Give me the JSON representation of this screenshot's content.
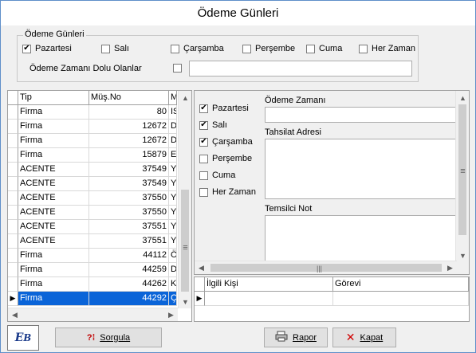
{
  "window": {
    "title": "Ödeme Günleri"
  },
  "filter": {
    "group_label": "Ödeme Günleri",
    "days": [
      {
        "label": "Pazartesi",
        "checked": true
      },
      {
        "label": "Salı",
        "checked": false
      },
      {
        "label": "Çarşamba",
        "checked": false
      },
      {
        "label": "Perşembe",
        "checked": false
      },
      {
        "label": "Cuma",
        "checked": false
      },
      {
        "label": "Her Zaman",
        "checked": false
      }
    ],
    "dolu_label": "Ödeme Zamanı Dolu Olanlar",
    "dolu_checked": false,
    "dolu_value": ""
  },
  "grid": {
    "headers": [
      "Tip",
      "Müş.No",
      "M"
    ],
    "rows": [
      {
        "tip": "Firma",
        "no": "80",
        "m": "IS"
      },
      {
        "tip": "Firma",
        "no": "12672",
        "m": "D"
      },
      {
        "tip": "Firma",
        "no": "12672",
        "m": "D"
      },
      {
        "tip": "Firma",
        "no": "15879",
        "m": "E"
      },
      {
        "tip": "ACENTE",
        "no": "37549",
        "m": "Y"
      },
      {
        "tip": "ACENTE",
        "no": "37549",
        "m": "Y"
      },
      {
        "tip": "ACENTE",
        "no": "37550",
        "m": "Y"
      },
      {
        "tip": "ACENTE",
        "no": "37550",
        "m": "Y"
      },
      {
        "tip": "ACENTE",
        "no": "37551",
        "m": "Y"
      },
      {
        "tip": "ACENTE",
        "no": "37551",
        "m": "Y"
      },
      {
        "tip": "Firma",
        "no": "44112",
        "m": "Ö"
      },
      {
        "tip": "Firma",
        "no": "44259",
        "m": "D"
      },
      {
        "tip": "Firma",
        "no": "44262",
        "m": "K"
      },
      {
        "tip": "Firma",
        "no": "44292",
        "m": "Ç"
      }
    ],
    "selected_index": 13
  },
  "detail": {
    "days": [
      {
        "label": "Pazartesi",
        "checked": true
      },
      {
        "label": "Salı",
        "checked": true
      },
      {
        "label": "Çarşamba",
        "checked": true
      },
      {
        "label": "Perşembe",
        "checked": false
      },
      {
        "label": "Cuma",
        "checked": false
      },
      {
        "label": "Her Zaman",
        "checked": false
      }
    ],
    "odeme_zamani_label": "Ödeme Zamanı",
    "odeme_zamani_value": "",
    "tahsilat_label": "Tahsilat Adresi",
    "tahsilat_value": "",
    "temsilci_label": "Temsilci Not",
    "temsilci_value": ""
  },
  "contacts": {
    "headers": [
      "İlgili Kişi",
      "Görevi"
    ]
  },
  "buttons": {
    "logo_text": "EB",
    "sorgula": "Sorgula",
    "rapor": "Rapor",
    "kapat": "Kapat"
  }
}
